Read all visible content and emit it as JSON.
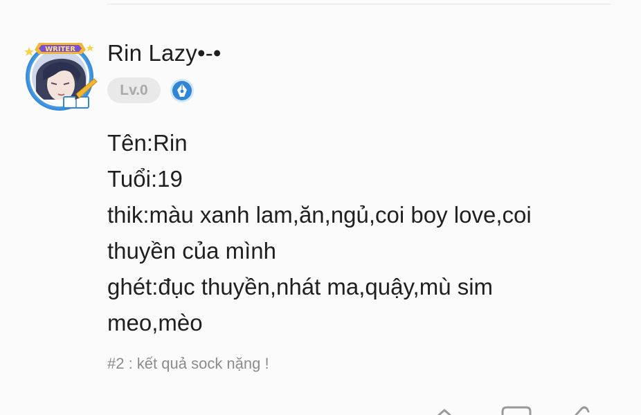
{
  "author": {
    "name": "Rin Lazy•-•",
    "level": "Lv.0",
    "avatar_frame_label": "WRITER",
    "writer_badge_icon": "pen-nib-icon"
  },
  "post": {
    "lines": [
      "Tên:Rin",
      "Tuổi:19",
      "thik:màu xanh lam,ăn,ngủ,coi boy love,coi thuyền của mình",
      "ghét:đục thuyền,nhát ma,quậy,mù sim meo,mèo"
    ],
    "tag": "#2 : kết quả sock nặng !"
  },
  "actions": {
    "icons": [
      "share-icon",
      "comment-icon",
      "like-icon"
    ]
  },
  "colors": {
    "accent_blue": "#2f86d6",
    "badge_gold": "#f2b632",
    "level_bg": "#e9e9e9",
    "level_text": "#a9a9a9",
    "tag_text": "#8b8b8b"
  }
}
